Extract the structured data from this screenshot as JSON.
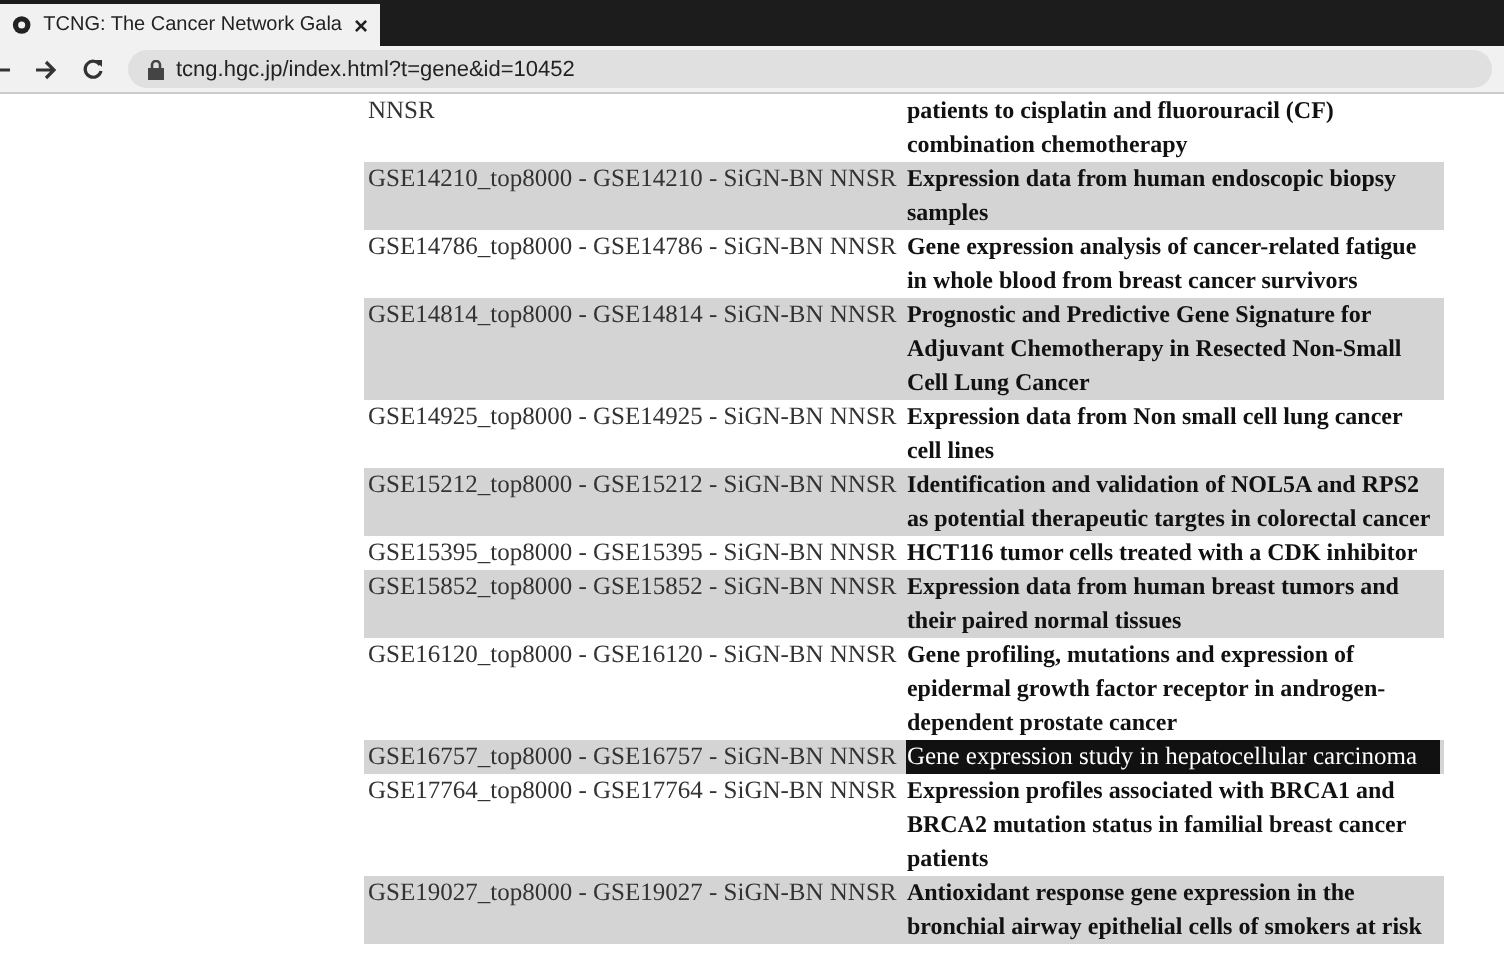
{
  "browser": {
    "tab_title": "TCNG: The Cancer Network Gala",
    "tab_close": "×",
    "url": "tcng.hgc.jp/index.html?t=gene&id=10452"
  },
  "table": {
    "rows": [
      {
        "dataset": "NNSR",
        "description": "patients to cisplatin and fluorouracil (CF) combination chemotherapy",
        "highlighted": false
      },
      {
        "dataset": "GSE14210_top8000 - GSE14210 - SiGN-BN NNSR",
        "description": "Expression data from human endoscopic biopsy samples",
        "highlighted": false
      },
      {
        "dataset": "GSE14786_top8000 - GSE14786 - SiGN-BN NNSR",
        "description": "Gene expression analysis of cancer-related fatigue in whole blood from breast cancer survivors",
        "highlighted": false
      },
      {
        "dataset": "GSE14814_top8000 - GSE14814 - SiGN-BN NNSR",
        "description": "Prognostic and Predictive Gene Signature for Adjuvant Chemotherapy in Resected Non-Small Cell Lung Cancer",
        "highlighted": false
      },
      {
        "dataset": "GSE14925_top8000 - GSE14925 - SiGN-BN NNSR",
        "description": "Expression data from Non small cell lung cancer cell lines",
        "highlighted": false
      },
      {
        "dataset": "GSE15212_top8000 - GSE15212 - SiGN-BN NNSR",
        "description": "Identification and validation of NOL5A and RPS2 as potential therapeutic targtes in colorectal cancer",
        "highlighted": false
      },
      {
        "dataset": "GSE15395_top8000 - GSE15395 - SiGN-BN NNSR",
        "description": "HCT116 tumor cells treated with a CDK inhibitor",
        "highlighted": false
      },
      {
        "dataset": "GSE15852_top8000 - GSE15852 - SiGN-BN NNSR",
        "description": "Expression data from human breast tumors and their paired normal tissues",
        "highlighted": false
      },
      {
        "dataset": "GSE16120_top8000 - GSE16120 - SiGN-BN NNSR",
        "description": "Gene profiling, mutations and expression of epidermal growth factor receptor in androgen-dependent prostate cancer",
        "highlighted": false
      },
      {
        "dataset": "GSE16757_top8000 - GSE16757 - SiGN-BN NNSR",
        "description": "Gene expression study in hepatocellular carcinoma",
        "highlighted": true
      },
      {
        "dataset": "GSE17764_top8000 - GSE17764 - SiGN-BN NNSR",
        "description": "Expression profiles associated with BRCA1 and BRCA2 mutation status in familial breast cancer patients",
        "highlighted": false
      },
      {
        "dataset": "GSE19027_top8000 - GSE19027 - SiGN-BN NNSR",
        "description": "Antioxidant response gene expression in the bronchial airway epithelial cells of smokers at risk",
        "highlighted": false
      }
    ]
  }
}
